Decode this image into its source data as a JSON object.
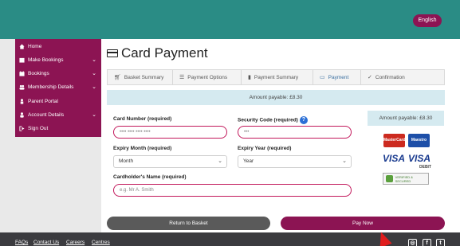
{
  "header": {
    "language_button": "English"
  },
  "sidebar": {
    "items": [
      {
        "label": "Home",
        "icon": "home-icon",
        "has_chevron": false
      },
      {
        "label": "Make Bookings",
        "icon": "bookings-icon",
        "has_chevron": true
      },
      {
        "label": "Bookings",
        "icon": "calendar-icon",
        "has_chevron": true
      },
      {
        "label": "Membership Details",
        "icon": "group-icon",
        "has_chevron": true
      },
      {
        "label": "Parent Portal",
        "icon": "user-icon",
        "has_chevron": false
      },
      {
        "label": "Account Details",
        "icon": "user-icon",
        "has_chevron": true
      },
      {
        "label": "Sign Out",
        "icon": "signout-icon",
        "has_chevron": false
      }
    ]
  },
  "page": {
    "title": "Card Payment"
  },
  "steps": [
    {
      "label": "Basket Summary",
      "icon": "cart-icon",
      "active": false
    },
    {
      "label": "Payment Options",
      "icon": "list-icon",
      "active": false
    },
    {
      "label": "Payment Summary",
      "icon": "document-icon",
      "active": false
    },
    {
      "label": "Payment",
      "icon": "card-icon",
      "active": true
    },
    {
      "label": "Confirmation",
      "icon": "check-icon",
      "active": false
    }
  ],
  "amount": {
    "label": "Amount payable: £8.30"
  },
  "form": {
    "card_number": {
      "label": "Card Number (required)",
      "placeholder": "•••• •••• •••• ••••"
    },
    "security_code": {
      "label": "Security Code (required)",
      "placeholder": "•••"
    },
    "expiry_month": {
      "label": "Expiry Month (required)",
      "value": "Month"
    },
    "expiry_year": {
      "label": "Expiry Year (required)",
      "value": "Year"
    },
    "cardholder": {
      "label": "Cardholder's Name (required)",
      "placeholder": "e.g. Mr A. Smith"
    }
  },
  "side_panel": {
    "amount": "Amount payable: £8.30",
    "mastercard": "MasterCard",
    "maestro": "Maestro",
    "visa": "VISA",
    "visa_debit": "VISA",
    "debit_label": "DEBIT",
    "secure_badge": "VERIFIED & SECURED"
  },
  "buttons": {
    "return": "Return to Basket",
    "pay": "Pay Now"
  },
  "footer": {
    "links": [
      "FAQs",
      "Contact Us",
      "Careers",
      "Centres"
    ]
  },
  "colors": {
    "brand": "#8c1453",
    "header": "#2a8c85",
    "info": "#d5eaf0"
  }
}
